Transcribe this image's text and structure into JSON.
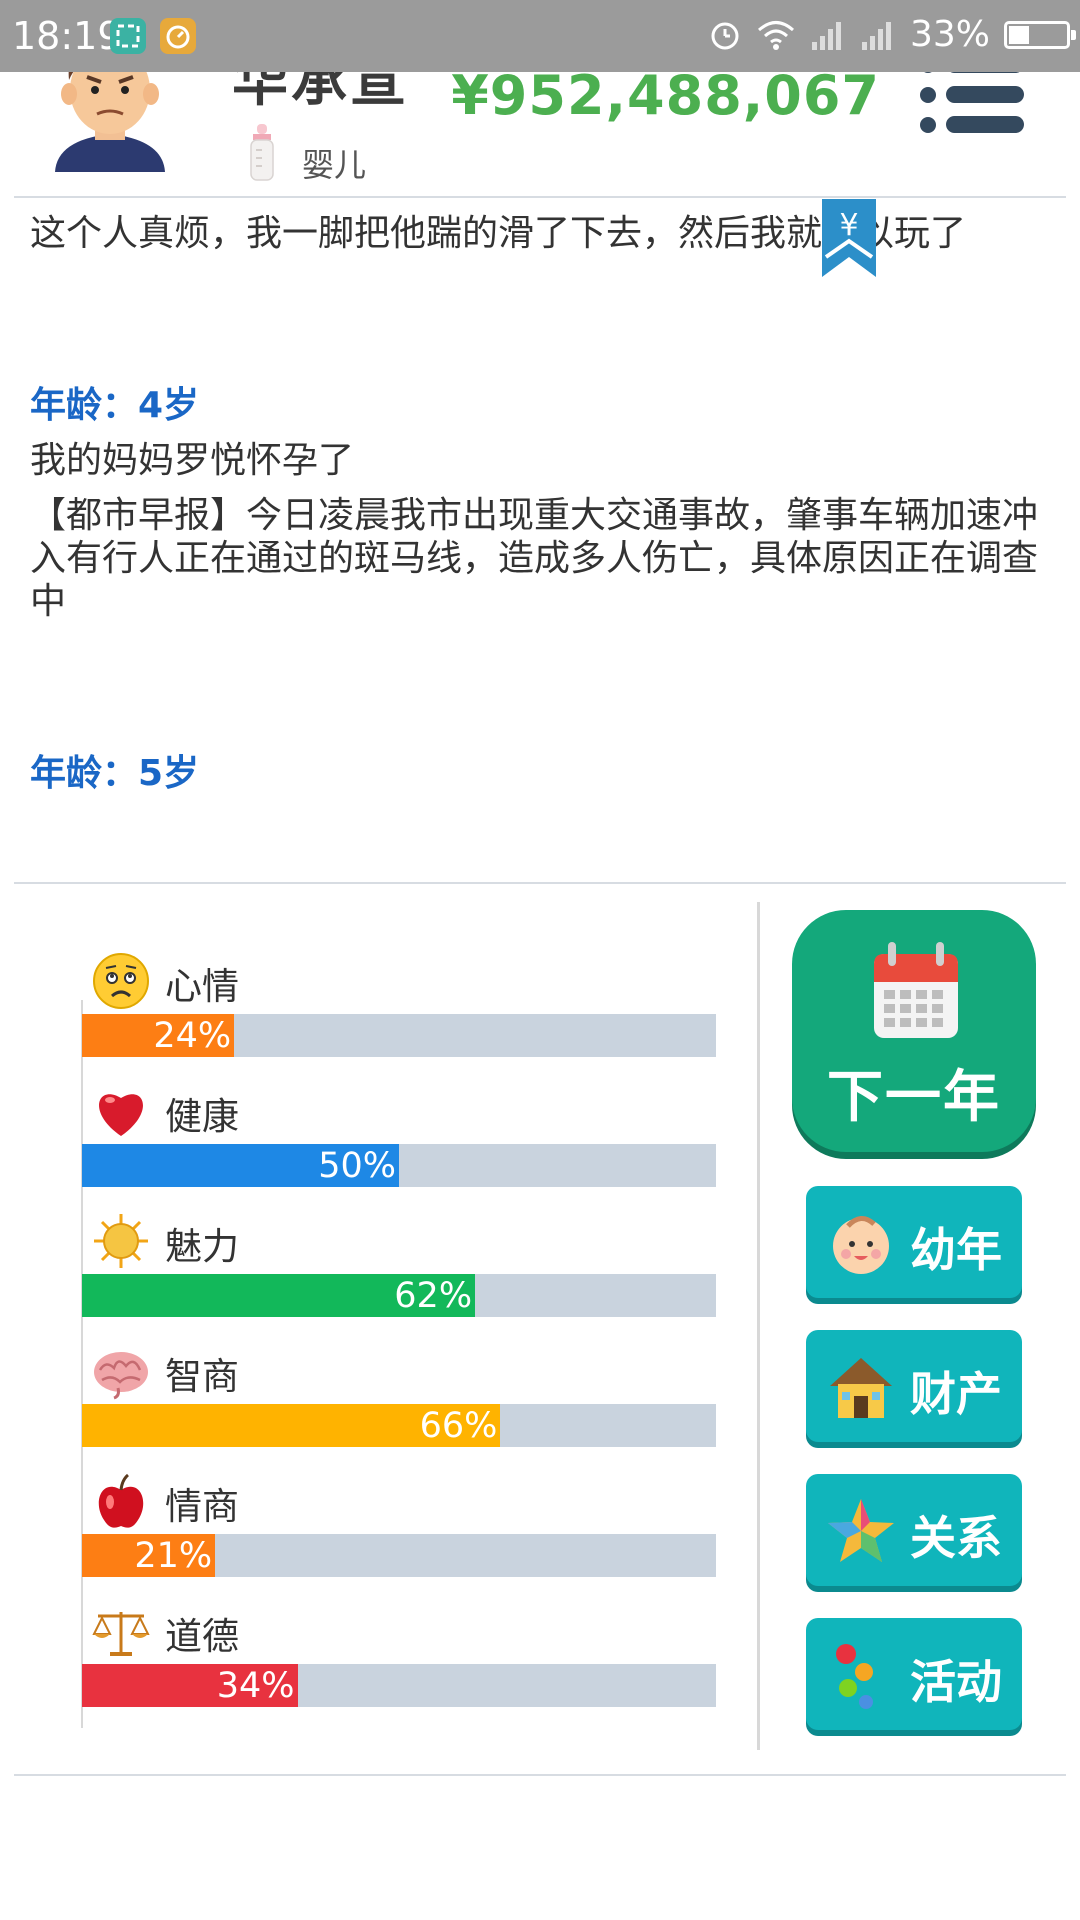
{
  "status_bar": {
    "time": "18:19",
    "battery": "33%"
  },
  "header": {
    "name": "华承宣",
    "stage": "婴儿",
    "money": "¥952,488,067"
  },
  "log": {
    "event_1": "这个人真烦，我一脚把他踹的滑了下去，然后我就可以玩了",
    "age_1": "年龄：4岁",
    "event_2": "我的妈妈罗悦怀孕了",
    "event_3": "【都市早报】今日凌晨我市出现重大交通事故，肇事车辆加速冲入有行人正在通过的斑马线，造成多人伤亡，具体原因正在调查中",
    "age_2": "年龄：5岁"
  },
  "stats": [
    {
      "label": "心情",
      "percent": 24,
      "text": "24%",
      "color": "#fd7e14",
      "icon": "worried-face-icon"
    },
    {
      "label": "健康",
      "percent": 50,
      "text": "50%",
      "color": "#1e88e5",
      "icon": "heart-icon"
    },
    {
      "label": "魅力",
      "percent": 62,
      "text": "62%",
      "color": "#12b85a",
      "icon": "sun-icon"
    },
    {
      "label": "智商",
      "percent": 66,
      "text": "66%",
      "color": "#ffb300",
      "icon": "brain-icon"
    },
    {
      "label": "情商",
      "percent": 21,
      "text": "21%",
      "color": "#fd7e14",
      "icon": "apple-icon"
    },
    {
      "label": "道德",
      "percent": 34,
      "text": "34%",
      "color": "#e8323f",
      "icon": "scales-icon"
    }
  ],
  "buttons": {
    "next_year": "下一年",
    "childhood": "幼年",
    "assets": "财产",
    "relations": "关系",
    "activities": "活动"
  },
  "colors": {
    "money": "#4caf50",
    "age": "#1a67c6",
    "next_year_button": "#14a87b",
    "side_button": "#10b5bb"
  }
}
